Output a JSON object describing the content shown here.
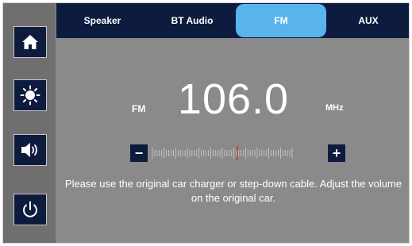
{
  "sidebar": {
    "items": [
      {
        "icon": "home-icon"
      },
      {
        "icon": "brightness-icon"
      },
      {
        "icon": "volume-icon"
      },
      {
        "icon": "power-icon"
      }
    ]
  },
  "tabs": [
    {
      "label": "Speaker",
      "active": false
    },
    {
      "label": "BT Audio",
      "active": false
    },
    {
      "label": "FM",
      "active": true
    },
    {
      "label": "AUX",
      "active": false
    }
  ],
  "radio": {
    "band": "FM",
    "frequency": "106.0",
    "unit": "MHz",
    "minus_label": "−",
    "plus_label": "+"
  },
  "notice": "Please use the original car charger or step-down cable. Adjust the volume on the original car.",
  "colors": {
    "panel": "#8a8a8a",
    "sidebar": "#6f6f6f",
    "navy": "#0d1b3e",
    "active_tab": "#5ab4ec",
    "needle": "#e02020"
  }
}
